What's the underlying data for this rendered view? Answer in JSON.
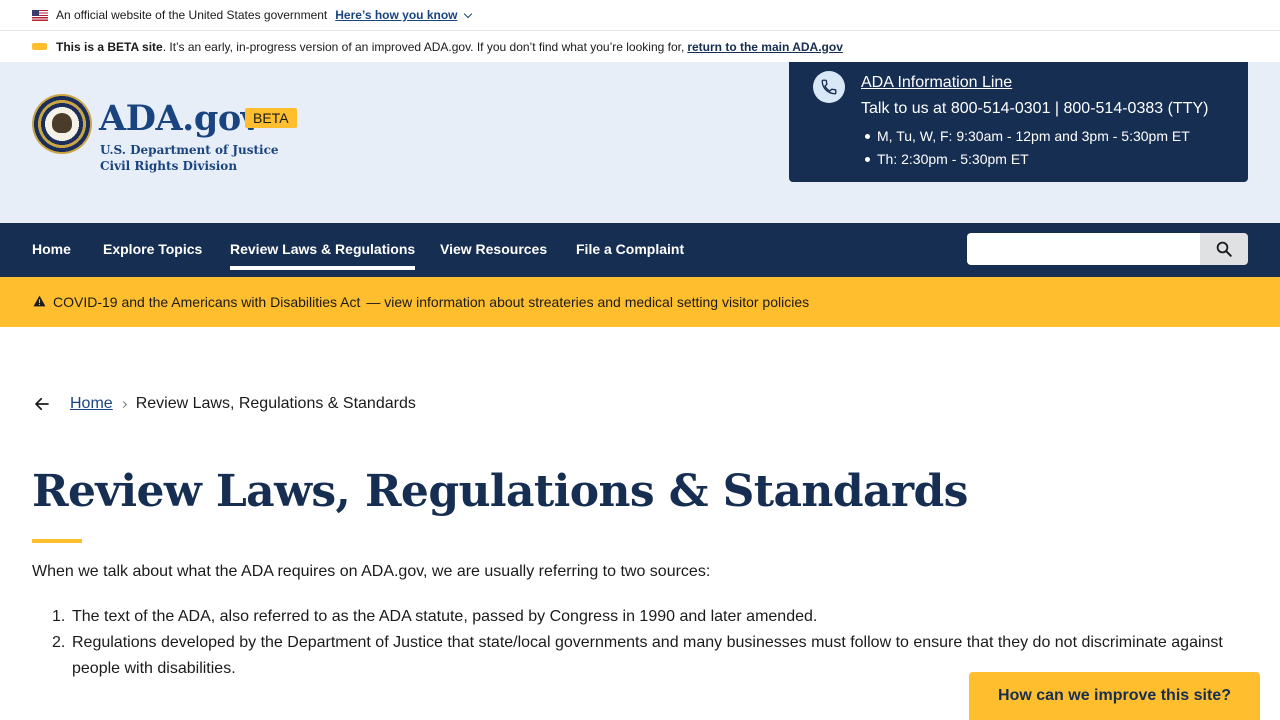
{
  "gov_banner": {
    "text": "An official website of the United States government",
    "link": "Here’s how you know"
  },
  "beta_banner": {
    "bold": "This is a BETA site",
    "text": ". It’s an early, in-progress version of an improved ADA.gov. If you don’t find what you’re looking for,",
    "link": "return to the main ADA.gov"
  },
  "header": {
    "logo_title": "ADA.gov",
    "beta_tag": "BETA",
    "sub1": "U.S. Department of Justice",
    "sub2": "Civil Rights Division",
    "info": {
      "title": "ADA Information Line",
      "talk": "Talk to us at 800-514-0301 | 800-514-0383 (TTY)",
      "hours": [
        "M, Tu, W, F: 9:30am - 12pm and 3pm - 5:30pm ET",
        "Th: 2:30pm - 5:30pm ET"
      ]
    }
  },
  "nav": {
    "items": [
      "Home",
      "Explore Topics",
      "Review Laws & Regulations",
      "View Resources",
      "File a Complaint"
    ],
    "active": "Review Laws & Regulations",
    "search_placeholder": ""
  },
  "alert": {
    "title": "COVID-19 and the Americans with Disabilities Act",
    "link": "— view information about streateries and medical setting visitor policies"
  },
  "breadcrumb": {
    "home": "Home",
    "current": "Review Laws, Regulations & Standards"
  },
  "main": {
    "title": "Review Laws, Regulations & Standards",
    "intro": "When we talk about what the ADA requires on ADA.gov, we are usually referring to two sources:",
    "sources": [
      {
        "num": "1.",
        "text": "The text of the ADA, also referred to as the ADA statute, passed by Congress in 1990 and later amended."
      },
      {
        "num": "2.",
        "text": "Regulations developed by the Department of Justice that state/local governments and many businesses must follow to ensure that they do not discriminate against people with disabilities."
      }
    ]
  },
  "feedback": {
    "label": "How can we improve this site?"
  },
  "colors": {
    "navy": "#162e51",
    "blue": "#1a4480",
    "gold": "#ffbe2e",
    "header_bg": "#e8eef7"
  },
  "icons": [
    "us-flag-icon",
    "chevron-down-icon",
    "phone-icon",
    "search-icon",
    "warning-icon",
    "arrow-left-icon",
    "chevron-right-icon"
  ]
}
